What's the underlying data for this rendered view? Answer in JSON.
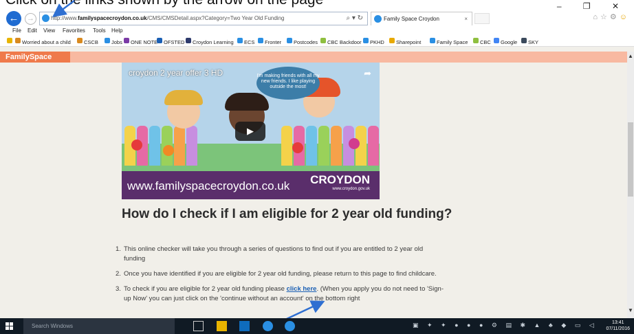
{
  "instruction_text": "Click on the links shown by the arrow on the page",
  "browser": {
    "url_prefix": "http://www.",
    "url_domain": "familyspacecroydon.co.uk",
    "url_path": "/CMS/CMSDetail.aspx?Category=Two Year Old Funding",
    "url_tools": "⌕ ▾ ↻",
    "tab_title": "Family Space Croydon",
    "tab_close": "×",
    "window_controls": "– ❐ ✕",
    "menu": [
      "File",
      "Edit",
      "View",
      "Favorites",
      "Tools",
      "Help"
    ],
    "favorites": [
      "Worried about a child",
      "CSCB",
      "Jobs",
      "ONE NOTE",
      "OFSTED",
      "Croydon Learning",
      "ECS",
      "Fronter",
      "Postcodes",
      "CBC Backdoor",
      "PKHD",
      "Sharepoint",
      "Family Space",
      "CBC",
      "Google",
      "SKY"
    ]
  },
  "site": {
    "logo": "FamilySpace"
  },
  "video": {
    "title": "croydon 2 year offer 3 HD",
    "bubble_text": "I'm making friends with all my new friends. I like playing outside the most!",
    "banner_url": "www.familyspacecroydon.co.uk",
    "banner_brand": "CROYDON",
    "banner_brand_sub": "www.croydon.gov.uk"
  },
  "content": {
    "heading": "How do I check if I am eligible for 2 year old funding?",
    "items": [
      {
        "num": "1.",
        "text": "This online checker will take you through a series of questions to find out if you are entitled to 2 year old funding"
      },
      {
        "num": "2.",
        "text": "Once you have identified if you are eligible for 2 year old funding, please return to this page to find childcare."
      },
      {
        "num": "3.",
        "text_before": "To check if you are eligible for 2 year old funding please ",
        "link": "click here",
        "text_after": ". (When you apply you do not need to 'Sign-up Now' you can just click on the 'continue without an account' on the bottom right"
      }
    ]
  },
  "taskbar": {
    "search_placeholder": "Search Windows",
    "time": "13:41",
    "date": "07/11/2016"
  },
  "colors": {
    "brand_orange": "#ef7a4b",
    "header_peach": "#f8b9a1",
    "video_banner": "#5a2e6b",
    "link_blue": "#1a5fb4",
    "arrow_blue": "#2f6fd1"
  }
}
